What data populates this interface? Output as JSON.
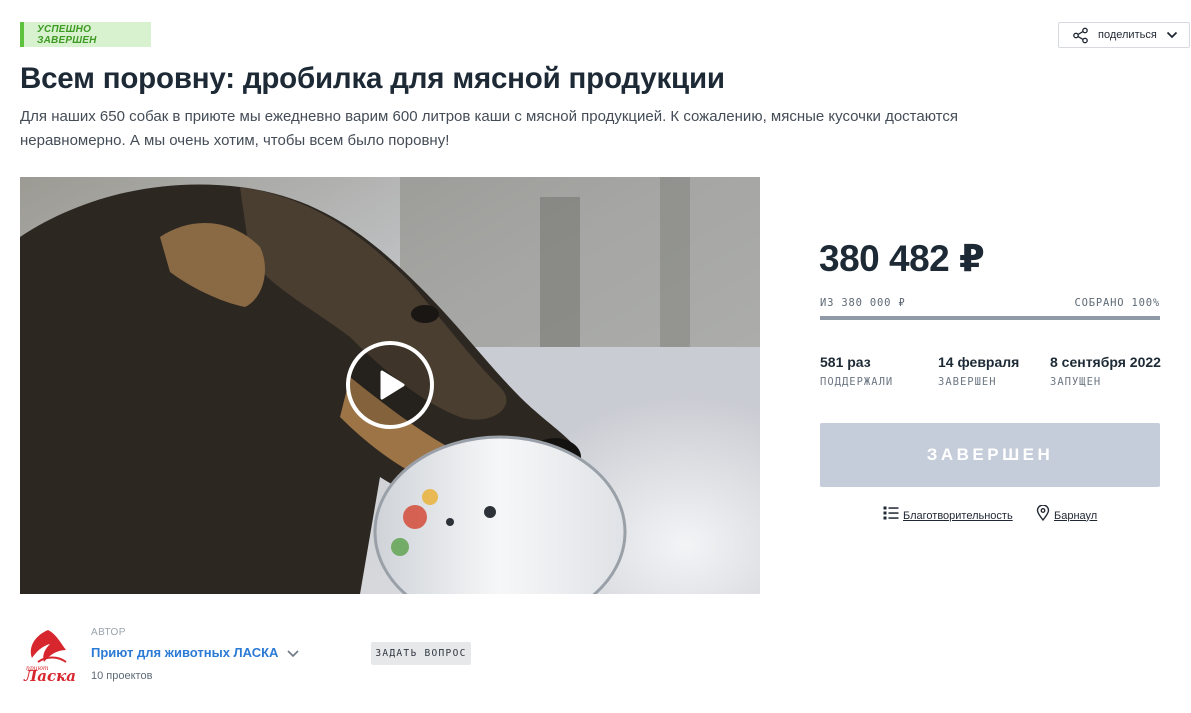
{
  "status": {
    "label": "УСПЕШНО ЗАВЕРШЕН",
    "color": "#5fc23f"
  },
  "share": {
    "label": "поделиться",
    "icon": "share-icon"
  },
  "project": {
    "title": "Всем поровну: дробилка для мясной продукции",
    "description": "Для наших 650 собак в приюте мы ежедневно варим 600 литров каши с мясной продукцией. К сожалению, мясные кусочки достаются неравномерно. А мы очень хотим, чтобы всем было поровну!"
  },
  "media": {
    "type": "video",
    "play_icon": "play-icon"
  },
  "funding": {
    "amount": "380 482 ₽",
    "goal": "ИЗ 380 000 ₽",
    "collected": "СОБРАНО 100%",
    "progress_percent": 100
  },
  "stats": [
    {
      "value": "581 раз",
      "label": "ПОДДЕРЖАЛИ"
    },
    {
      "value": "14 февраля",
      "label": "ЗАВЕРШЕН"
    },
    {
      "value": "8 сентября 2022",
      "label": "ЗАПУЩЕН"
    }
  ],
  "action": {
    "label": "ЗАВЕРШЕН"
  },
  "meta": {
    "category": "Благотворительность",
    "location": "Барнаул"
  },
  "author": {
    "caption": "АВТОР",
    "name": "Приют для животных ЛАСКА",
    "projects": "10 проектов",
    "logo_text_top": "приют",
    "logo_text": "Ласка",
    "ask_label": "ЗАДАТЬ ВОПРОС"
  }
}
